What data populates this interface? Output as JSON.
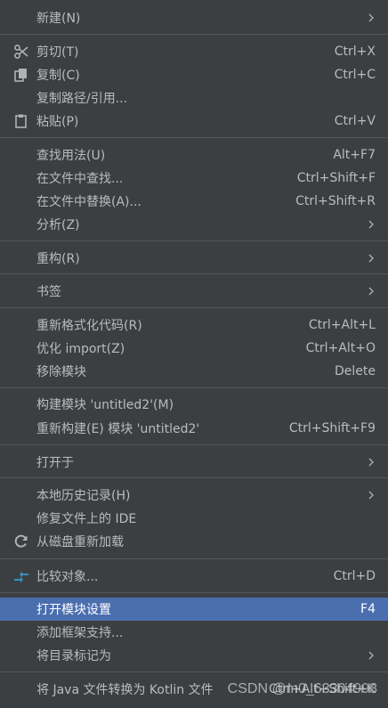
{
  "menu": {
    "items": [
      {
        "label": "新建(N)",
        "shortcut": "",
        "submenu": true
      },
      {
        "label": "剪切(T)",
        "shortcut": "Ctrl+X",
        "icon": "scissors-icon"
      },
      {
        "label": "复制(C)",
        "shortcut": "Ctrl+C",
        "icon": "copy-icon"
      },
      {
        "label": "复制路径/引用...",
        "shortcut": ""
      },
      {
        "label": "粘贴(P)",
        "shortcut": "Ctrl+V",
        "icon": "paste-icon"
      },
      {
        "label": "查找用法(U)",
        "shortcut": "Alt+F7"
      },
      {
        "label": "在文件中查找...",
        "shortcut": "Ctrl+Shift+F"
      },
      {
        "label": "在文件中替换(A)...",
        "shortcut": "Ctrl+Shift+R"
      },
      {
        "label": "分析(Z)",
        "shortcut": "",
        "submenu": true
      },
      {
        "label": "重构(R)",
        "shortcut": "",
        "submenu": true
      },
      {
        "label": "书签",
        "shortcut": "",
        "submenu": true
      },
      {
        "label": "重新格式化代码(R)",
        "shortcut": "Ctrl+Alt+L"
      },
      {
        "label": "优化 import(Z)",
        "shortcut": "Ctrl+Alt+O"
      },
      {
        "label": "移除模块",
        "shortcut": "Delete"
      },
      {
        "label": "构建模块 'untitled2'(M)",
        "shortcut": ""
      },
      {
        "label": "重新构建(E) 模块 'untitled2'",
        "shortcut": "Ctrl+Shift+F9"
      },
      {
        "label": "打开于",
        "shortcut": "",
        "submenu": true
      },
      {
        "label": "本地历史记录(H)",
        "shortcut": "",
        "submenu": true
      },
      {
        "label": "修复文件上的 IDE",
        "shortcut": ""
      },
      {
        "label": "从磁盘重新加载",
        "shortcut": "",
        "icon": "reload-icon"
      },
      {
        "label": "比较对象...",
        "shortcut": "Ctrl+D",
        "icon": "compare-icon"
      },
      {
        "label": "打开模块设置",
        "shortcut": "F4",
        "selected": true
      },
      {
        "label": "添加框架支持...",
        "shortcut": ""
      },
      {
        "label": "将目录标记为",
        "shortcut": "",
        "submenu": true
      },
      {
        "label": "将 Java 文件转换为 Kotlin 文件",
        "shortcut": "Ctrl+Alt+Shift+K"
      }
    ]
  },
  "watermark": "CSDN @m0_63304993",
  "colors": {
    "background": "#3c3f41",
    "selected": "#4b6eaf",
    "separator": "#515658",
    "text": "#bbbbbb"
  }
}
